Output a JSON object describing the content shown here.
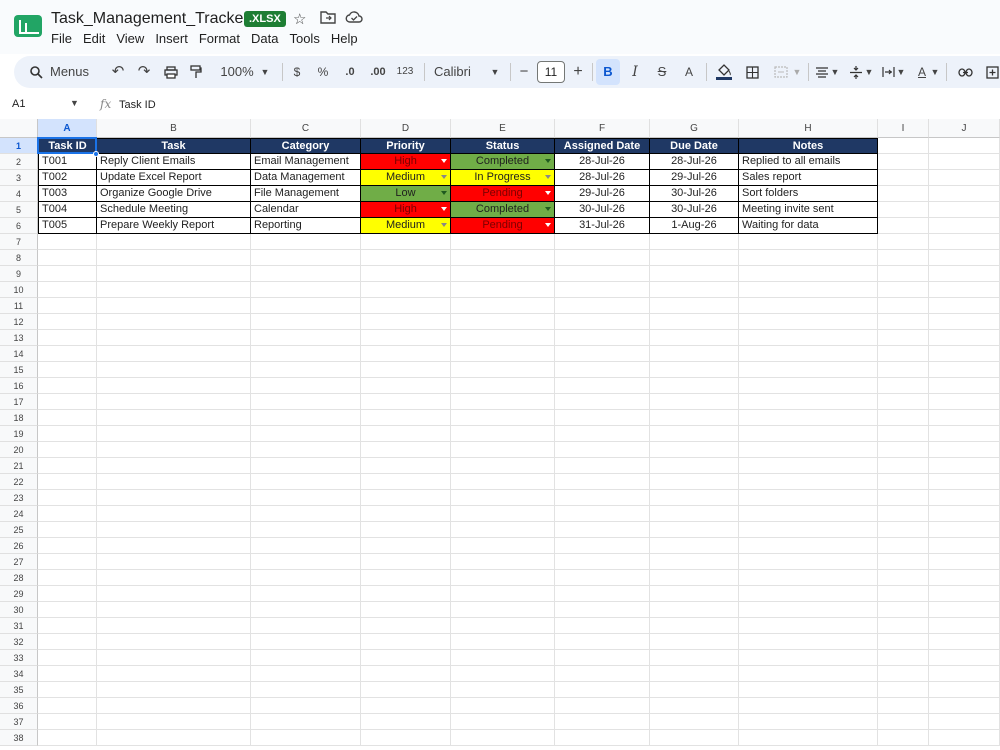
{
  "window": {
    "doc_title": "Task_Management_Tracker",
    "badge": ".XLSX",
    "icons": [
      "star-icon",
      "move-to-folder-icon",
      "cloud-saved-icon"
    ]
  },
  "menu": [
    "File",
    "Edit",
    "View",
    "Insert",
    "Format",
    "Data",
    "Tools",
    "Help"
  ],
  "toolbar": {
    "menus_label": "Menus",
    "zoom": "100%",
    "currency": "$",
    "percent": "%",
    "dec_decrease": ".0",
    "dec_increase": ".00",
    "number_format": "123",
    "font": "Calibri",
    "font_size": "11",
    "minus": "−",
    "plus": "+",
    "bold": "B",
    "italic": "I",
    "strike": "S",
    "text_color": "A"
  },
  "formula_bar": {
    "cell_ref": "A1",
    "fx": "fx",
    "content": "Task ID"
  },
  "columns": [
    "A",
    "B",
    "C",
    "D",
    "E",
    "F",
    "G",
    "H",
    "I",
    "J"
  ],
  "rows": [
    "1",
    "2",
    "3",
    "4",
    "5",
    "6",
    "7",
    "8",
    "9",
    "10",
    "11",
    "12",
    "13",
    "14",
    "15",
    "16",
    "17",
    "18",
    "19",
    "20",
    "21",
    "22",
    "23",
    "24",
    "25",
    "26",
    "27",
    "28",
    "29",
    "30",
    "31",
    "32",
    "33",
    "34",
    "35",
    "36",
    "37",
    "38"
  ],
  "headers": [
    "Task ID",
    "Task",
    "Category",
    "Priority",
    "Status",
    "Assigned Date",
    "Due Date",
    "Notes"
  ],
  "tasks": [
    {
      "id": "T001",
      "task": "Reply Client Emails",
      "category": "Email Management",
      "priority": "High",
      "status": "Completed",
      "assigned": "28-Jul-26",
      "due": "28-Jul-26",
      "notes": "Replied to all emails"
    },
    {
      "id": "T002",
      "task": "Update Excel Report",
      "category": "Data Management",
      "priority": "Medium",
      "status": "In Progress",
      "assigned": "28-Jul-26",
      "due": "29-Jul-26",
      "notes": "Sales report"
    },
    {
      "id": "T003",
      "task": "Organize Google Drive",
      "category": "File Management",
      "priority": "Low",
      "status": "Pending",
      "assigned": "29-Jul-26",
      "due": "30-Jul-26",
      "notes": "Sort folders"
    },
    {
      "id": "T004",
      "task": "Schedule Meeting",
      "category": "Calendar",
      "priority": "High",
      "status": "Completed",
      "assigned": "30-Jul-26",
      "due": "30-Jul-26",
      "notes": "Meeting invite sent"
    },
    {
      "id": "T005",
      "task": "Prepare Weekly Report",
      "category": "Reporting",
      "priority": "Medium",
      "status": "Pending",
      "assigned": "31-Jul-26",
      "due": "1-Aug-26",
      "notes": "Waiting for data"
    }
  ],
  "colors": {
    "header_bg": "#1f3864",
    "high": "#ff0000",
    "medium": "#ffff00",
    "low": "#70ad47",
    "completed": "#70ad47",
    "in_progress": "#ffff00",
    "pending": "#ff0000",
    "accent": "#1a73e8"
  }
}
